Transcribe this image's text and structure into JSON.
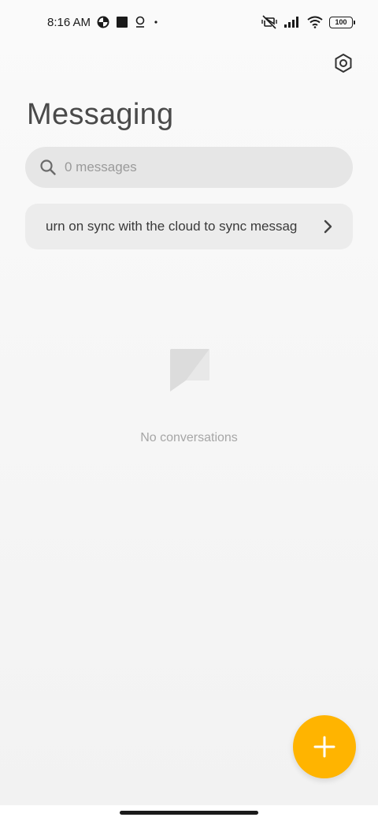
{
  "status_bar": {
    "time": "8:16 AM",
    "battery": "100",
    "icons": [
      "data-saver-icon",
      "square-notification-icon",
      "location-pin-icon",
      "dot-icon",
      "vibrate-off-icon",
      "signal-icon",
      "wifi-icon",
      "battery-icon"
    ]
  },
  "header": {
    "title": "Messaging",
    "settings_icon": "settings-hexagon-icon"
  },
  "search": {
    "placeholder": "0 messages",
    "value": ""
  },
  "sync_banner": {
    "text": "urn on sync with the cloud to sync messag"
  },
  "empty_state": {
    "icon": "message-bubble-icon",
    "text": "No conversations"
  },
  "fab": {
    "icon": "plus-icon"
  },
  "colors": {
    "accent": "#ffb400",
    "title": "#4a4a4a",
    "search_bg": "#e6e6e6",
    "banner_bg": "#ececec",
    "empty_text": "#a6a6a6"
  }
}
